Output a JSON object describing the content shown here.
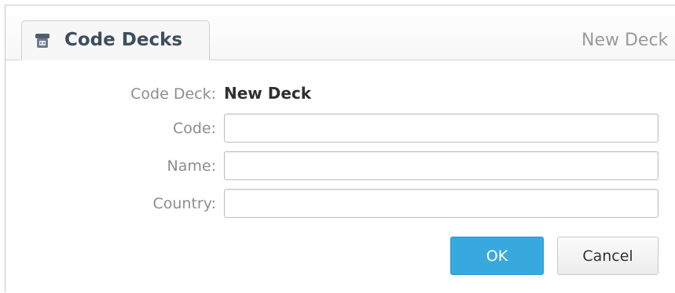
{
  "header": {
    "tab_label": "Code Decks",
    "right_title": "New Deck",
    "tab_icon": "phone-icon"
  },
  "form": {
    "code_deck_label": "Code Deck:",
    "code_deck_value": "New Deck",
    "code_label": "Code:",
    "code_value": "",
    "name_label": "Name:",
    "name_value": "",
    "country_label": "Country:",
    "country_value": ""
  },
  "buttons": {
    "ok_label": "OK",
    "cancel_label": "Cancel"
  },
  "colors": {
    "accent": "#38a9de",
    "tab_text": "#3c4d5f",
    "label_text": "#8d8d8d"
  }
}
